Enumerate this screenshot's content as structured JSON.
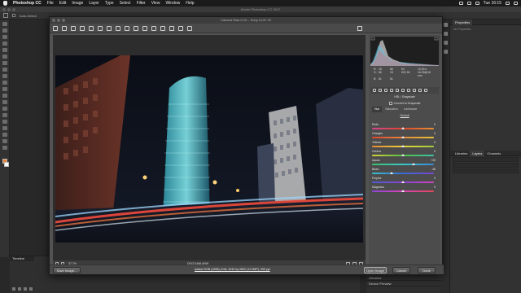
{
  "menubar": {
    "app_name": "Photoshop CC",
    "menus": [
      "File",
      "Edit",
      "Image",
      "Layer",
      "Type",
      "Select",
      "Filter",
      "View",
      "Window",
      "Help"
    ],
    "clock": "Tue 16:15"
  },
  "photoshop": {
    "window_title": "Adobe Photoshop CC 2017",
    "options_bar_label": "Auto-Select",
    "panels": {
      "properties_tab": "Properties",
      "properties_empty": "No Properties",
      "layers_tabs": [
        "Libraries",
        "Layers",
        "Channels"
      ],
      "timeline_tab": "Timeline",
      "bottom_tabs": [
        "Libraries",
        "Device Preview"
      ]
    }
  },
  "camera_raw": {
    "title": "Camera Raw 9.10  –  Sony ILCE-7S",
    "zoom": "37,7%",
    "filename": "DSC01468.ARW",
    "readouts": {
      "rows": [
        {
          "ch": "R:",
          "v1": "18",
          "v2": "86",
          "s1": "f/4",
          "s2": "10,00 s"
        },
        {
          "ch": "G:",
          "v1": "86",
          "v2": "18",
          "s1": "ISO 50",
          "s2": "16-35@16 mm"
        },
        {
          "ch": "B:",
          "v1": "61",
          "v2": "61",
          "s1": "",
          "s2": ""
        }
      ]
    },
    "panel_title": "HSL / Grayscale",
    "convert_label": "Convert to Grayscale",
    "hsl_tabs": [
      "Hue",
      "Saturation",
      "Luminance"
    ],
    "default_label": "Default",
    "sliders": [
      {
        "name": "Reds",
        "value": "0",
        "pos": 0.5,
        "track": "reds"
      },
      {
        "name": "Oranges",
        "value": "0",
        "pos": 0.5,
        "track": "oranges"
      },
      {
        "name": "Yellows",
        "value": "0",
        "pos": 0.5,
        "track": "yellows"
      },
      {
        "name": "Greens",
        "value": "0",
        "pos": 0.5,
        "track": "greens"
      },
      {
        "name": "Aquas",
        "value": "+33",
        "pos": 0.665,
        "track": "aquas"
      },
      {
        "name": "Blues",
        "value": "-38",
        "pos": 0.31,
        "track": "blues"
      },
      {
        "name": "Purples",
        "value": "0",
        "pos": 0.5,
        "track": "purples"
      },
      {
        "name": "Magentas",
        "value": "0",
        "pos": 0.5,
        "track": "magentas"
      }
    ],
    "buttons": {
      "save": "Save Image...",
      "open": "Open Image",
      "cancel": "Cancel",
      "done": "Done"
    },
    "workflow_text": "Adobe RGB (1998); 8 bit; 4240 by 2832 (12.0MP); 300 ppi"
  },
  "colors": {
    "foreground": "#e8823a",
    "background": "#ffffff",
    "dialog_bg": "#535353"
  }
}
